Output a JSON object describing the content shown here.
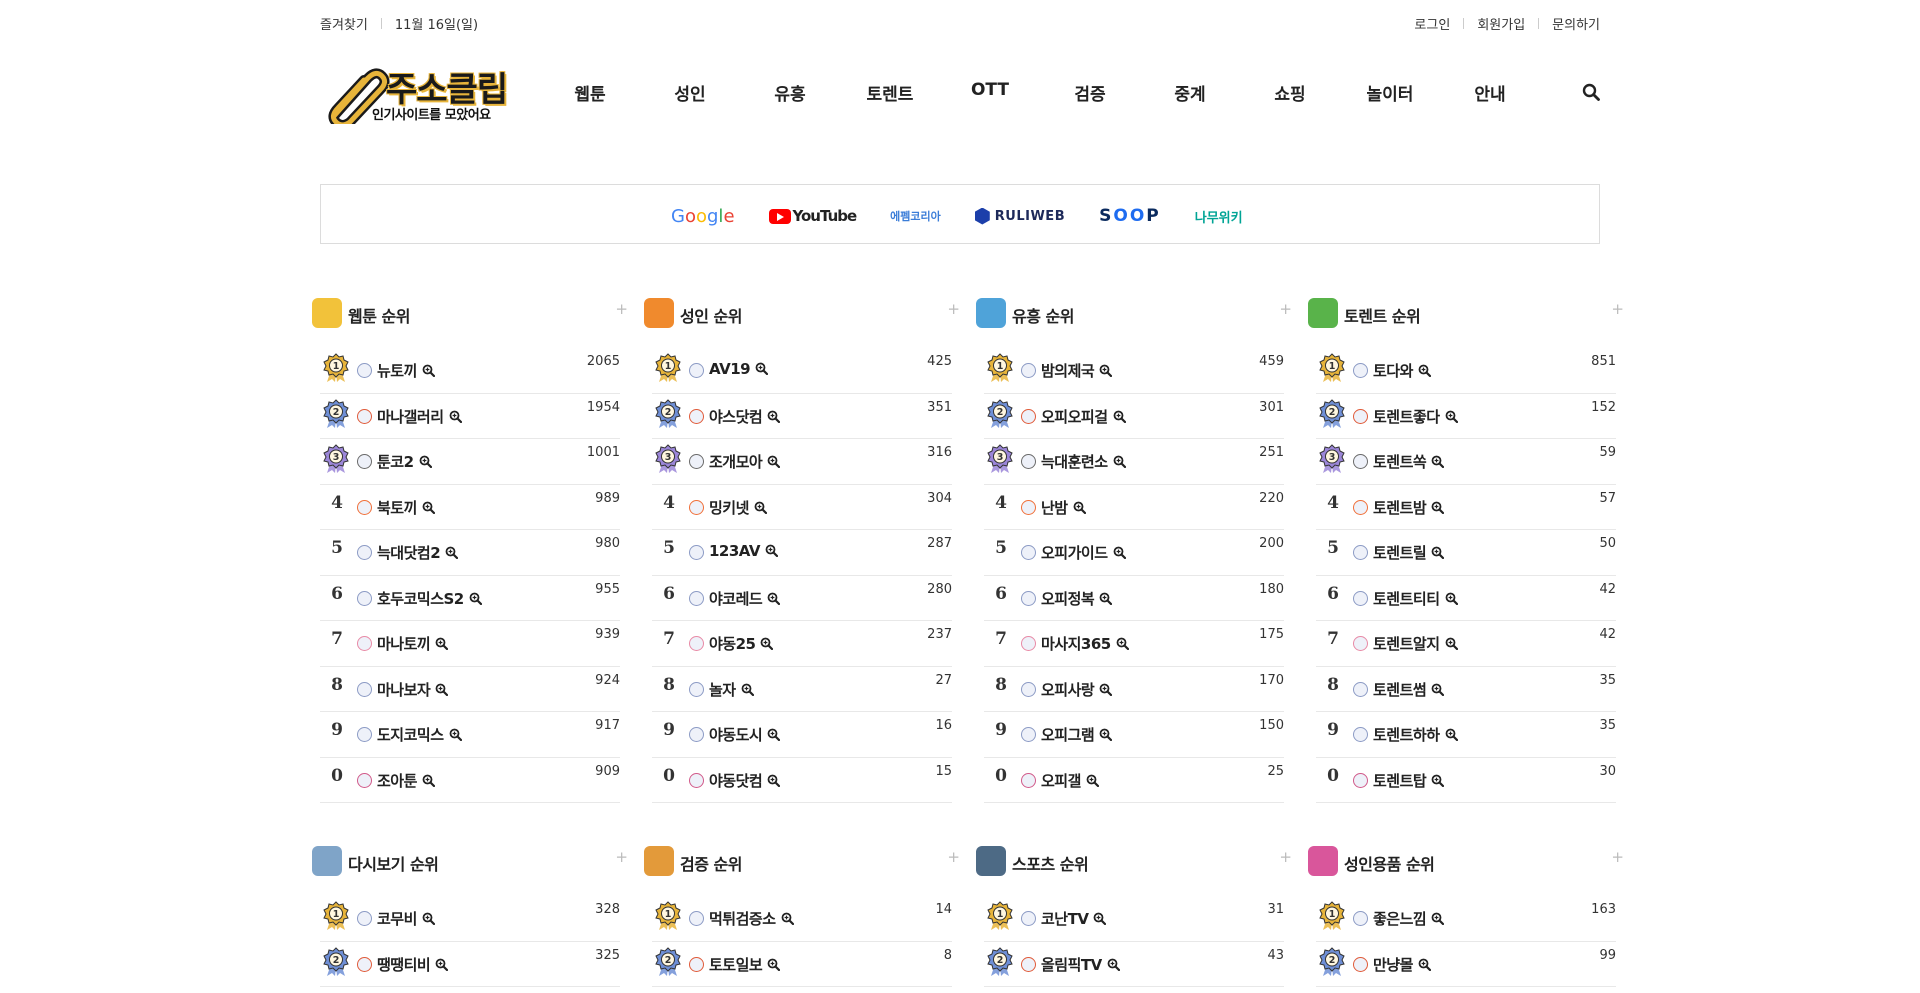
{
  "topbar": {
    "bookmark": "즐겨찾기",
    "date": "11월 16일(일)",
    "login": "로그인",
    "signup": "회원가입",
    "contact": "문의하기"
  },
  "logo": {
    "name": "주소클립",
    "tagline": "인기사이트를 모았어요"
  },
  "nav": [
    "웹툰",
    "성인",
    "유흥",
    "토렌트",
    "OTT",
    "검증",
    "중계",
    "쇼핑",
    "놀이터",
    "안내"
  ],
  "quick_links": {
    "google": "Google",
    "youtube": "YouTube",
    "fmkorea": "에펨코리아",
    "ruliweb": "RULIWEB",
    "soop": "SOOP",
    "namu": "나무위키"
  },
  "colors": {
    "gold": "#e7b43a",
    "silver": "#6f8fd6",
    "bronze": "#9b86d8"
  },
  "panels": [
    {
      "title": "웹툰 순위",
      "icon": "webtoon-icon",
      "items": [
        {
          "rank": "1",
          "name": "뉴토끼",
          "count": "2065"
        },
        {
          "rank": "2",
          "name": "마나갤러리",
          "count": "1954"
        },
        {
          "rank": "3",
          "name": "툰코2",
          "count": "1001"
        },
        {
          "rank": "4",
          "name": "북토끼",
          "count": "989"
        },
        {
          "rank": "5",
          "name": "늑대닷컴2",
          "count": "980"
        },
        {
          "rank": "6",
          "name": "호두코믹스S2",
          "count": "955"
        },
        {
          "rank": "7",
          "name": "마나토끼",
          "count": "939"
        },
        {
          "rank": "8",
          "name": "마나보자",
          "count": "924"
        },
        {
          "rank": "9",
          "name": "도지코믹스",
          "count": "917"
        },
        {
          "rank": "0",
          "name": "조아툰",
          "count": "909"
        }
      ]
    },
    {
      "title": "성인 순위",
      "icon": "xxx-icon",
      "items": [
        {
          "rank": "1",
          "name": "AV19",
          "count": "425"
        },
        {
          "rank": "2",
          "name": "야스닷컴",
          "count": "351"
        },
        {
          "rank": "3",
          "name": "조개모아",
          "count": "316"
        },
        {
          "rank": "4",
          "name": "밍키넷",
          "count": "304"
        },
        {
          "rank": "5",
          "name": "123AV",
          "count": "287"
        },
        {
          "rank": "6",
          "name": "야코레드",
          "count": "280"
        },
        {
          "rank": "7",
          "name": "야동25",
          "count": "237"
        },
        {
          "rank": "8",
          "name": "놀자",
          "count": "27"
        },
        {
          "rank": "9",
          "name": "야동도시",
          "count": "16"
        },
        {
          "rank": "0",
          "name": "야동닷컴",
          "count": "15"
        }
      ]
    },
    {
      "title": "유흥 순위",
      "icon": "cocktail-icon",
      "items": [
        {
          "rank": "1",
          "name": "밤의제국",
          "count": "459"
        },
        {
          "rank": "2",
          "name": "오피오피걸",
          "count": "301"
        },
        {
          "rank": "3",
          "name": "늑대훈련소",
          "count": "251"
        },
        {
          "rank": "4",
          "name": "난밤",
          "count": "220"
        },
        {
          "rank": "5",
          "name": "오피가이드",
          "count": "200"
        },
        {
          "rank": "6",
          "name": "오피정복",
          "count": "180"
        },
        {
          "rank": "7",
          "name": "마사지365",
          "count": "175"
        },
        {
          "rank": "8",
          "name": "오피사랑",
          "count": "170"
        },
        {
          "rank": "9",
          "name": "오피그램",
          "count": "150"
        },
        {
          "rank": "0",
          "name": "오피갤",
          "count": "25"
        }
      ]
    },
    {
      "title": "토렌트 순위",
      "icon": "utorrent-icon",
      "items": [
        {
          "rank": "1",
          "name": "토다와",
          "count": "851"
        },
        {
          "rank": "2",
          "name": "토렌트좋다",
          "count": "152"
        },
        {
          "rank": "3",
          "name": "토렌트쏙",
          "count": "59"
        },
        {
          "rank": "4",
          "name": "토렌트밤",
          "count": "57"
        },
        {
          "rank": "5",
          "name": "토렌트릴",
          "count": "50"
        },
        {
          "rank": "6",
          "name": "토렌트티티",
          "count": "42"
        },
        {
          "rank": "7",
          "name": "토렌트알지",
          "count": "42"
        },
        {
          "rank": "8",
          "name": "토렌트썸",
          "count": "35"
        },
        {
          "rank": "9",
          "name": "토렌트하하",
          "count": "35"
        },
        {
          "rank": "0",
          "name": "토렌트탑",
          "count": "30"
        }
      ]
    },
    {
      "title": "다시보기 순위",
      "icon": "tv-icon",
      "items": [
        {
          "rank": "1",
          "name": "코무비",
          "count": "328"
        },
        {
          "rank": "2",
          "name": "땡땡티비",
          "count": "325"
        }
      ]
    },
    {
      "title": "검증 순위",
      "icon": "police-icon",
      "items": [
        {
          "rank": "1",
          "name": "먹튀검증소",
          "count": "14"
        },
        {
          "rank": "2",
          "name": "토토일보",
          "count": "8"
        }
      ]
    },
    {
      "title": "스포츠 순위",
      "icon": "sports-monitor-icon",
      "items": [
        {
          "rank": "1",
          "name": "코난TV",
          "count": "31"
        },
        {
          "rank": "2",
          "name": "올림픽TV",
          "count": "43"
        }
      ]
    },
    {
      "title": "성인용품 순위",
      "icon": "adult-goods-icon",
      "items": [
        {
          "rank": "1",
          "name": "좋은느낌",
          "count": "163"
        },
        {
          "rank": "2",
          "name": "만냥몰",
          "count": "99"
        }
      ]
    }
  ]
}
